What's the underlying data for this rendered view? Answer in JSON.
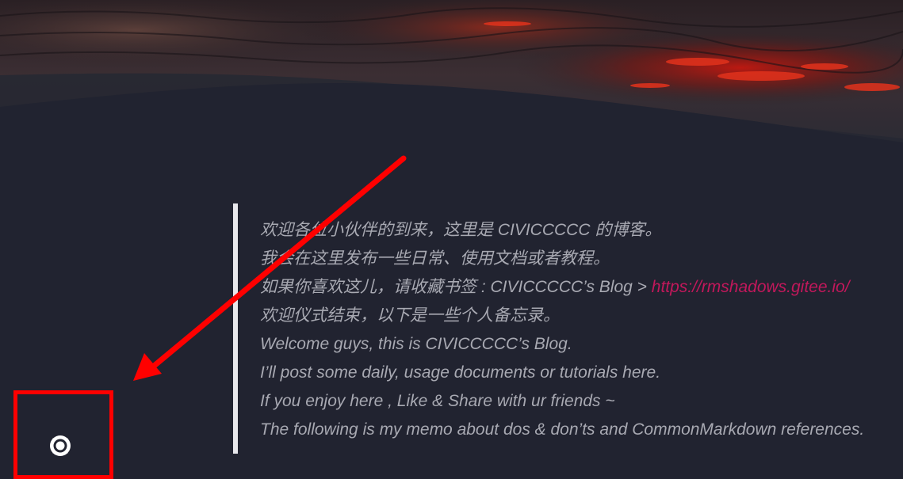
{
  "blockquote": {
    "lines": [
      {
        "text": "欢迎各位小伙伴的到来，这里是 CIVICCCCC 的博客。"
      },
      {
        "text": "我会在这里发布一些日常、使用文档或者教程。"
      },
      {
        "text": "如果你喜欢这儿，请收藏书签 : CIVICCCCC’s Blog > ",
        "link": "https://rmshadows.gitee.io/"
      },
      {
        "text": "欢迎仪式结束，以下是一些个人备忘录。"
      },
      {
        "text": "Welcome guys, this is CIVICCCCC’s Blog."
      },
      {
        "text": "I’ll post some daily, usage documents or tutorials here."
      },
      {
        "text": "If you enjoy here , Like & Share with ur friends ~"
      },
      {
        "text": "The following is my memo about dos & don’ts and CommonMarkdown references."
      }
    ]
  },
  "theme_toggle": {
    "icon": "brightness-icon"
  },
  "colors": {
    "background": "#212330",
    "text": "#a8a9b2",
    "link": "#c2185b",
    "quote_border": "#e8e8ec",
    "annotation": "#ff0000"
  }
}
